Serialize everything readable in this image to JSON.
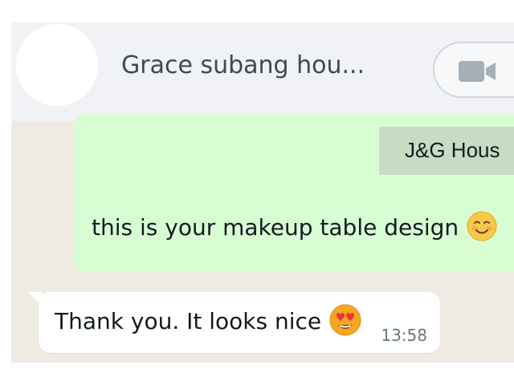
{
  "header": {
    "contact_name": "Grace subang hou...",
    "avatar_icon": "avatar-placeholder",
    "call_icon": "video-call-icon",
    "icon_color": "#8696a0"
  },
  "messages": [
    {
      "direction": "outgoing",
      "document_title": "J&G Hous",
      "text": "this is your makeup table design",
      "emoji": "smiling-face-icon",
      "bubble_color": "#d9fdd3"
    },
    {
      "direction": "incoming",
      "text": "Thank you. It looks nice",
      "emoji": "heart-eyes-icon",
      "time": "13:58",
      "bubble_color": "#ffffff"
    }
  ],
  "colors": {
    "header_bg": "#f0f2f5",
    "chat_bg": "#efeae2",
    "document_header_bg": "#c6dcc3"
  }
}
